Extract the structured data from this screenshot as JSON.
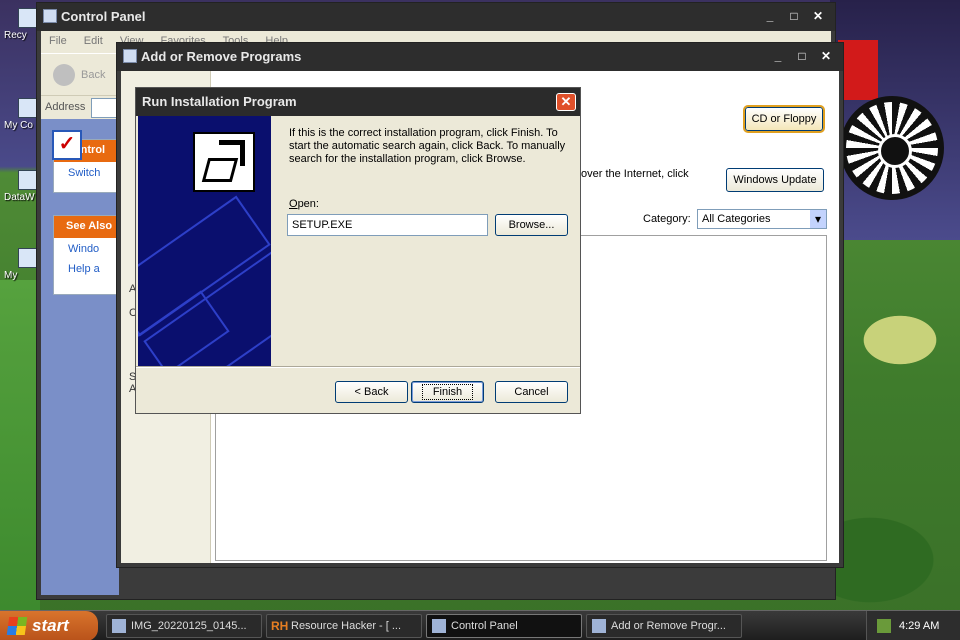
{
  "desktop": {
    "icons": [
      {
        "label": "Recy",
        "top": 0
      },
      {
        "label": "My Co",
        "top": 0
      },
      {
        "label": "DataW",
        "top": 0
      },
      {
        "label": "My",
        "top": 0
      }
    ]
  },
  "control_panel": {
    "title": "Control Panel",
    "menu": [
      "File",
      "Edit",
      "View",
      "Favorites",
      "Tools",
      "Help"
    ],
    "back_label": "Back",
    "address_label": "Address",
    "task_pane_title": "Control",
    "task_pane_item": "Switch",
    "see_also_title": "See Also",
    "see_also_items": [
      "Windo",
      "Help a"
    ]
  },
  "add_remove": {
    "title": "Add or Remove Programs",
    "cd_button": "CD or Floppy",
    "internet_text": "over the Internet, click",
    "windows_update_button": "Windows Update",
    "category_label": "Category:",
    "category_value": "All Categories",
    "left_letters": [
      "A",
      "C",
      "S",
      "A"
    ]
  },
  "dialog": {
    "title": "Run Installation Program",
    "message": "If this is the correct installation program, click Finish. To start the automatic search again, click Back. To manually search for the installation program, click Browse.",
    "open_label_first": "O",
    "open_label_rest": "pen:",
    "open_value": "SETUP.EXE",
    "browse_button": "Browse...",
    "back_button": "< Back",
    "finish_button": "Finish",
    "cancel_button": "Cancel"
  },
  "taskbar": {
    "start_label": "start",
    "tasks": [
      {
        "label": "IMG_20220125_0145...",
        "active": false
      },
      {
        "label": "Resource Hacker - [ ...",
        "active": false
      },
      {
        "label": "Control Panel",
        "active": true
      },
      {
        "label": "Add or Remove Progr...",
        "active": false
      }
    ],
    "clock": "4:29 AM"
  }
}
